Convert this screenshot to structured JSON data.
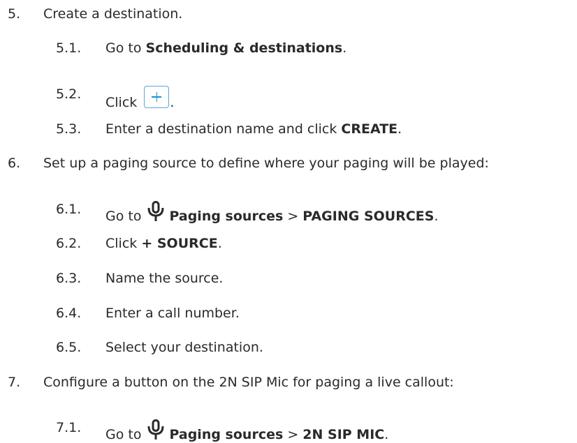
{
  "steps": [
    {
      "number": "5.",
      "text": "Create a destination.",
      "substeps": [
        {
          "number": "5.1.",
          "pre": "Go to ",
          "bold": "Scheduling & destinations",
          "post": "."
        },
        {
          "number": "5.2.",
          "pre": "Click ",
          "post": "."
        },
        {
          "number": "5.3.",
          "pre": "Enter a destination name and click ",
          "bold": "CREATE",
          "post": "."
        }
      ]
    },
    {
      "number": "6.",
      "text": "Set up a paging source to define where your paging will be played:",
      "substeps": [
        {
          "number": "6.1.",
          "pre": "Go to",
          "bold": "Paging sources",
          "mid": " > ",
          "bold2": "PAGING SOURCES",
          "post": "."
        },
        {
          "number": "6.2.",
          "pre": "Click ",
          "bold": "+ SOURCE",
          "post": "."
        },
        {
          "number": "6.3.",
          "text": "Name the source."
        },
        {
          "number": "6.4.",
          "text": "Enter a call number."
        },
        {
          "number": "6.5.",
          "text": "Select your destination."
        }
      ]
    },
    {
      "number": "7.",
      "text": "Configure a button on the 2N SIP Mic for paging a live callout:",
      "substeps": [
        {
          "number": "7.1.",
          "pre": "Go to",
          "bold": "Paging sources",
          "mid": " > ",
          "bold2": "2N SIP MIC",
          "post": "."
        }
      ]
    }
  ],
  "icons": {
    "add": "plus-icon",
    "mic": "microphone-icon",
    "accent": "#1a8fd1"
  }
}
